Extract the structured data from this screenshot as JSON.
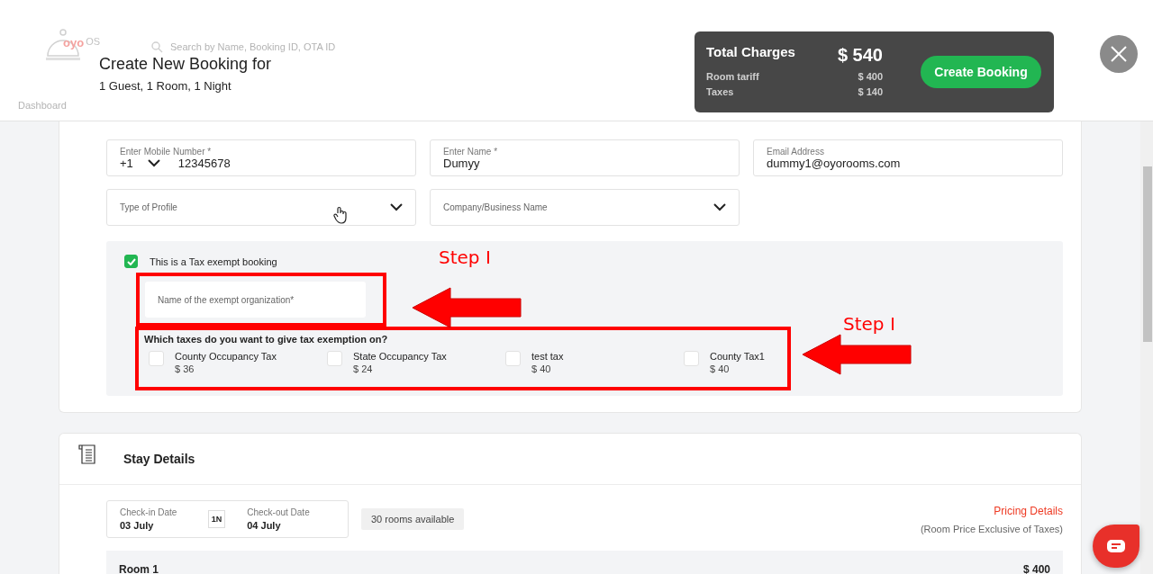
{
  "background_nav": {
    "brand": "oyo",
    "brand_suffix": "OS",
    "search_placeholder": "Search by Name, Booking ID, OTA ID",
    "menu_item": "Dashboard"
  },
  "header": {
    "title": "Create New Booking for",
    "subtitle": "1 Guest, 1 Room, 1 Night"
  },
  "charges": {
    "title": "Total Charges",
    "total": "$ 540",
    "lines": [
      {
        "label": "Room tariff",
        "value": "$ 400"
      },
      {
        "label": "Taxes",
        "value": "$ 140"
      }
    ],
    "button": "Create Booking"
  },
  "guest_fields": [
    {
      "kind": "phone",
      "label": "Enter Mobile Number *",
      "country_code": "+1",
      "value": "12345678"
    },
    {
      "kind": "text",
      "label": "Enter Name *",
      "value": "Dumyy"
    },
    {
      "kind": "text",
      "label": "Email Address",
      "value": "dummy1@oyorooms.com"
    },
    {
      "kind": "select",
      "placeholder": "Type of Profile"
    },
    {
      "kind": "select",
      "placeholder": "Company/Business Name"
    }
  ],
  "tax_exempt": {
    "checked": true,
    "label": "This is a Tax exempt booking",
    "org_field": {
      "placeholder": "Name of the exempt organization*"
    },
    "question": "Which taxes do you want to give tax exemption on?",
    "taxes": [
      {
        "name": "County Occupancy Tax",
        "amount": "$ 36",
        "checked": false
      },
      {
        "name": "State Occupancy Tax",
        "amount": "$ 24",
        "checked": false
      },
      {
        "name": "test tax",
        "amount": "$ 40",
        "checked": false
      },
      {
        "name": "County Tax1",
        "amount": "$ 40",
        "checked": false
      }
    ]
  },
  "stay": {
    "title": "Stay Details",
    "check_in": {
      "label": "Check-in Date",
      "value": "03 July"
    },
    "nights": "1N",
    "check_out": {
      "label": "Check-out Date",
      "value": "04 July"
    },
    "availability": "30 rooms available",
    "pricing_link": "Pricing Details",
    "pricing_note": "(Room Price Exclusive of Taxes)",
    "rooms": [
      {
        "name": "Room 1",
        "price": "$ 400"
      }
    ]
  },
  "annotations": [
    {
      "label": "Step I"
    },
    {
      "label": "Step I"
    }
  ]
}
